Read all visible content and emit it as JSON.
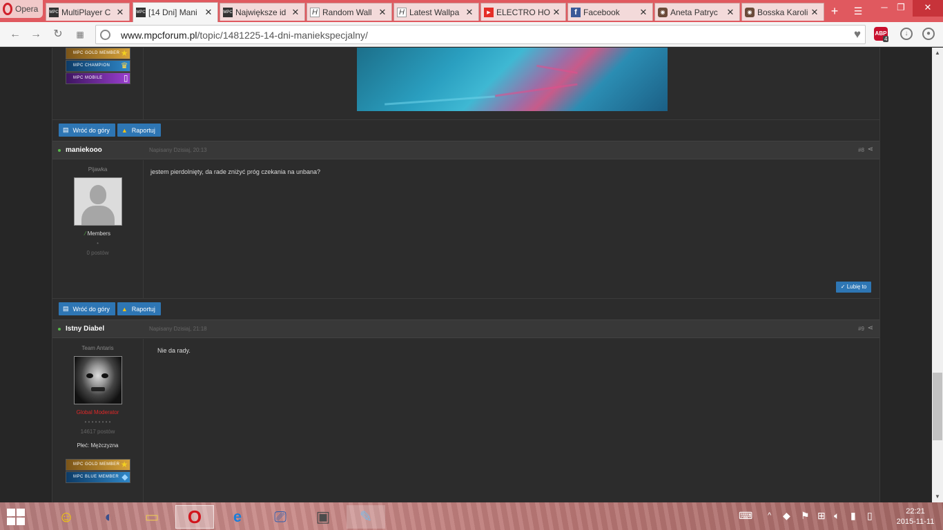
{
  "browser": {
    "menu_label": "Opera",
    "tabs": [
      {
        "title": "MultiPlayer C",
        "icon": "mpc-favicon",
        "active": false
      },
      {
        "title": "[14 Dni] Mani",
        "icon": "mpc-favicon",
        "active": true
      },
      {
        "title": "Największe id",
        "icon": "mpc-favicon",
        "active": false
      },
      {
        "title": "Random Wall",
        "icon": "h-favicon",
        "active": false
      },
      {
        "title": "Latest Wallpa",
        "icon": "h-favicon",
        "active": false
      },
      {
        "title": "ELECTRO HO",
        "icon": "youtube-favicon",
        "active": false
      },
      {
        "title": "Facebook",
        "icon": "facebook-favicon",
        "active": false
      },
      {
        "title": "Aneta Patryc",
        "icon": "instagram-favicon",
        "active": false
      },
      {
        "title": "Bosska Karoli",
        "icon": "instagram-favicon",
        "active": false
      }
    ],
    "url_domain": "www.mpcforum.pl",
    "url_path": "/topic/1481225-14-dni-maniekspecjalny/",
    "adblock_label": "ABP",
    "adblock_count": "4"
  },
  "badges_top": [
    {
      "label": "MPC GOLD MEMBER",
      "color": "#b8862b"
    },
    {
      "label": "MPC CHAMPION",
      "color": "#1e5f9a"
    },
    {
      "label": "MPC MOBILE",
      "color": "#6a2a9a"
    }
  ],
  "post_buttons": {
    "back_to_top": "Wróć do góry",
    "report": "Raportuj"
  },
  "posts": [
    {
      "author": "maniekooo",
      "date": "Napisany Dzisiaj, 20:13",
      "number": "#8",
      "user_title": "Pijawka",
      "group": "Members",
      "pips": "•",
      "post_count": "0 postów",
      "text": "jestem pierdolnięty, da rade zniżyć próg czekania na unbana?",
      "like_label": "✓ Lubię to"
    },
    {
      "author": "Istny Diabel",
      "date": "Napisany Dzisiaj, 21:18",
      "number": "#9",
      "user_title": "Team Antaris",
      "group": "Global Moderator",
      "pips": "• • • • • • • •",
      "post_count": "14617 postów",
      "gender": "Płeć: Mężczyzna",
      "text": "Nie da rady."
    }
  ],
  "badges_bottom": [
    {
      "label": "MPC GOLD MEMBER",
      "color": "#b8862b"
    },
    {
      "label": "MPC BLUE MEMBER",
      "color": "#1e5f9a"
    }
  ],
  "taskbar": {
    "time": "22:21",
    "date": "2015-11-11"
  },
  "colors": {
    "tab_strip": "#e0595f",
    "forum_bg": "#2c2c2c",
    "button_blue": "#2e76b4",
    "moderator_red": "#e02828",
    "online_green": "#59b94c"
  }
}
